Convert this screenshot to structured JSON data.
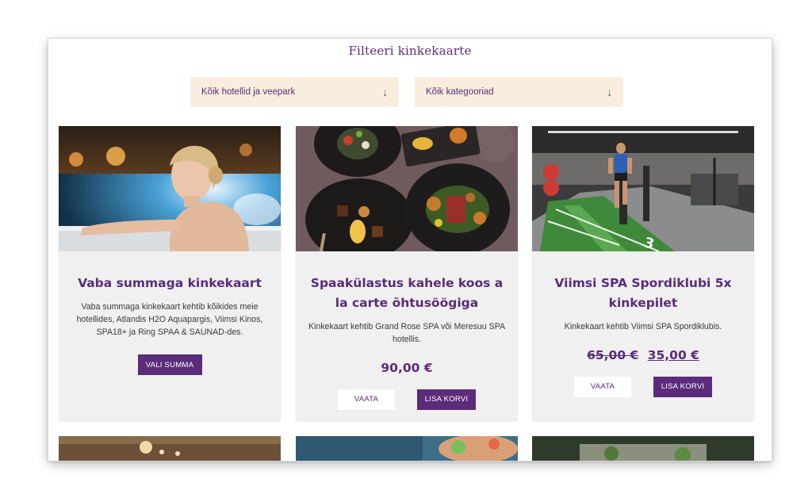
{
  "page_title": "Filteeri kinkekaarte",
  "filters": {
    "hotels": {
      "label": "Kõik hotellid ja veepark",
      "icon": "arrow-down-icon"
    },
    "categories": {
      "label": "Kõik kategooriad",
      "icon": "arrow-down-icon"
    }
  },
  "cards": [
    {
      "title": "Vaba summaga kinkekaart",
      "description": "Vaba summaga kinkekaart kehtib kõikides meie hotellides, Atlandis H2O Aquapargis, Viimsi Kinos, SPA18+ ja Ring SPAA & SAUNAD-des.",
      "button": "VALI SUMMA"
    },
    {
      "title": "Spaakülastus kahele koos a la carte õhtusöögiga",
      "description": "Kinkekaart kehtib Grand Rose SPA või Meresuu SPA hotellis.",
      "price": "90,00 €",
      "view_button": "VAATA",
      "cart_button": "LISA KORVI"
    },
    {
      "title": "Viimsi SPA Spordiklubi 5x kinkepilet",
      "description": "Kinkekaart kehtib Viimsi SPA Spordiklubis.",
      "old_price": "65,00 €",
      "price": "35,00 €",
      "view_button": "VAATA",
      "cart_button": "LISA KORVI"
    }
  ],
  "colors": {
    "brand": "#5b2c7a",
    "filter_bg": "#f9eedd",
    "card_bg": "#f0f0f0"
  }
}
